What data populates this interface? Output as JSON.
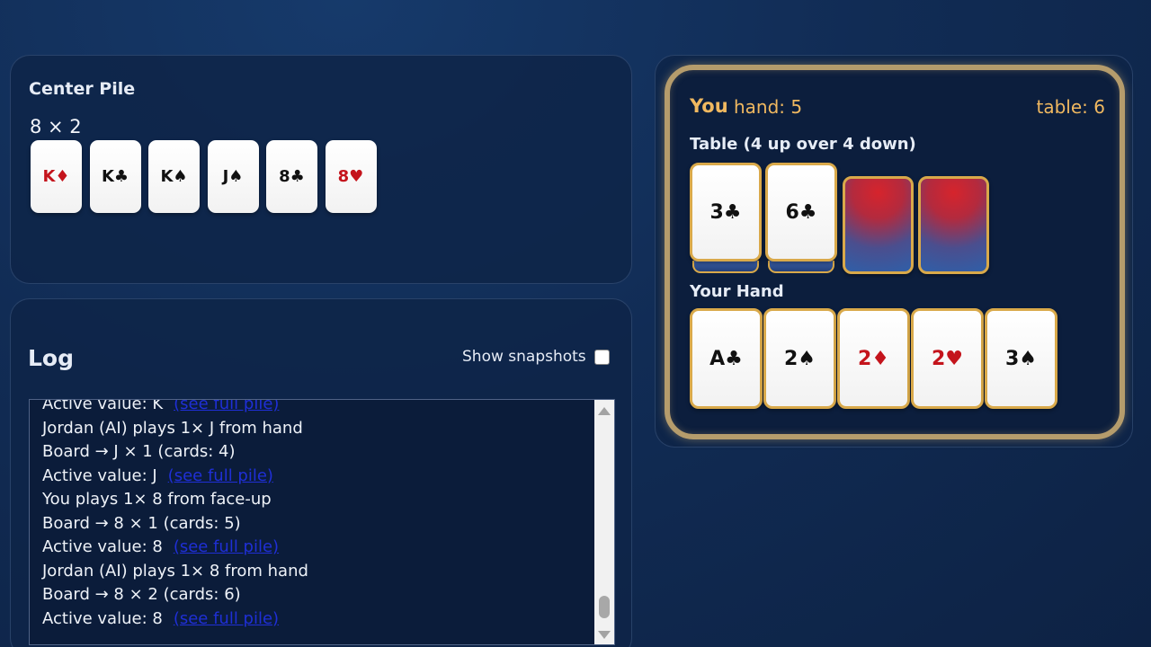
{
  "center": {
    "title": "Center Pile",
    "count_text": "8 × 2",
    "cards": [
      {
        "label": "K♦",
        "red": true
      },
      {
        "label": "K♣",
        "red": false
      },
      {
        "label": "K♠",
        "red": false
      },
      {
        "label": "J♠",
        "red": false
      },
      {
        "label": "8♣",
        "red": false
      },
      {
        "label": "8♥",
        "red": true
      }
    ]
  },
  "log": {
    "title": "Log",
    "snapshots_label": "Show snapshots",
    "link_text": "(see full pile)",
    "lines": [
      {
        "text": "Active value: K",
        "link": true
      },
      {
        "text": "Jordan (AI) plays 1× J from hand",
        "link": false
      },
      {
        "text": "Board → J × 1 (cards: 4)",
        "link": false
      },
      {
        "text": "Active value: J",
        "link": true
      },
      {
        "text": "You plays 1× 8 from face-up",
        "link": false
      },
      {
        "text": "Board → 8 × 1 (cards: 5)",
        "link": false
      },
      {
        "text": "Active value: 8",
        "link": true
      },
      {
        "text": "Jordan (AI) plays 1× 8 from hand",
        "link": false
      },
      {
        "text": "Board → 8 × 2 (cards: 6)",
        "link": false
      },
      {
        "text": "Active value: 8",
        "link": true
      }
    ]
  },
  "player": {
    "name": "You",
    "hand_text": "hand: 5",
    "table_text": "table: 6",
    "table_heading": "Table (4 up over 4 down)",
    "hand_heading": "Your Hand",
    "table_cards": [
      {
        "label": "3♣",
        "red": false,
        "face_up": true
      },
      {
        "label": "6♣",
        "red": false,
        "face_up": true
      },
      {
        "label": "",
        "red": false,
        "face_up": false
      },
      {
        "label": "",
        "red": false,
        "face_up": false
      }
    ],
    "hand_cards": [
      {
        "label": "A♣",
        "red": false
      },
      {
        "label": "2♠",
        "red": false
      },
      {
        "label": "2♦",
        "red": true
      },
      {
        "label": "2♥",
        "red": true
      },
      {
        "label": "3♠",
        "red": false
      }
    ]
  },
  "colors": {
    "accent_gold": "#f0b860",
    "card_red": "#c4141c",
    "frame_gold": "#b59c6c"
  }
}
